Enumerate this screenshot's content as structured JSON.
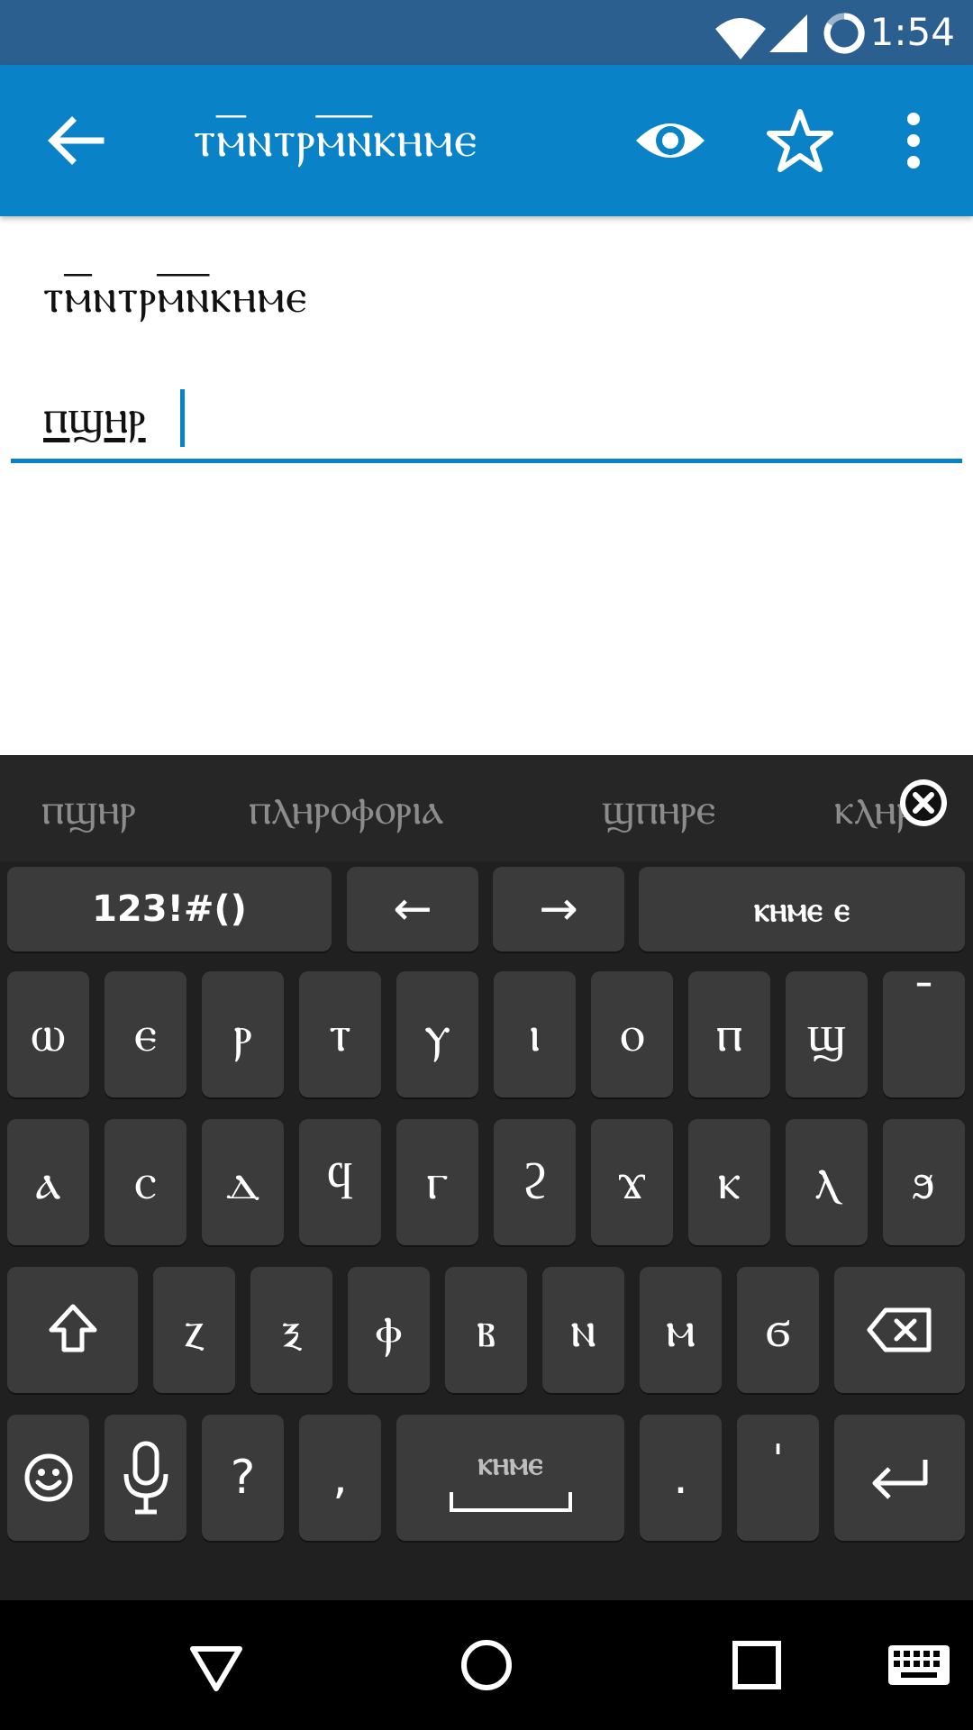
{
  "status_bar": {
    "time": "1:54",
    "icons": [
      "wifi-icon",
      "signal-icon",
      "sync-icon"
    ]
  },
  "app_bar": {
    "title": "ⲧⲙ̅ⲛⲧⲣⲙ̅ⲛ̅ⲕⲏⲙⲉ",
    "icons": [
      "back-arrow-icon",
      "eye-icon",
      "star-icon",
      "overflow-menu-icon"
    ]
  },
  "content": {
    "entry_word": "ⲧⲙ̅ⲛⲧⲣⲙ̅ⲛ̅ⲕⲏⲙⲉ",
    "edit_value": "ⲡϣⲏⲣ"
  },
  "keyboard": {
    "suggestions": [
      "ⲡϣⲏⲣ",
      "ⲡⲗⲏⲣⲟⲫⲟⲣⲓⲁ",
      "ϣⲡⲏⲣⲉ",
      "ⲕⲗⲏⲣⲟ"
    ],
    "function_row": {
      "symbols": "123!#()",
      "left": "←",
      "right": "→",
      "language": "ⲕⲏⲙⲉ ⲉ"
    },
    "row1": [
      "ⲱ",
      "ⲉ",
      "ⲣ",
      "ⲧ",
      "ⲩ",
      "ⲓ",
      "ⲟ",
      "ⲡ",
      "ϣ",
      "¯"
    ],
    "row2": [
      "ⲁ",
      "ⲥ",
      "ⲇ",
      "ϥ",
      "ⲅ",
      "ϩ",
      "ϫ",
      "ⲕ",
      "ⲗ",
      "ϧ"
    ],
    "row3": [
      "ⲍ",
      "ⲝ",
      "ⲫ",
      "ⲃ",
      "ⲛ",
      "ⲙ",
      "ϭ"
    ],
    "row4": {
      "question": "?",
      "comma": ",",
      "space": "ⲕⲏⲙⲉ",
      "period": ".",
      "apostrophe": "'"
    }
  },
  "colors": {
    "accent": "#0a82c8",
    "status_bar": "#2a5f8f",
    "keyboard_bg": "#202020",
    "key_bg": "#3b3b3b"
  }
}
